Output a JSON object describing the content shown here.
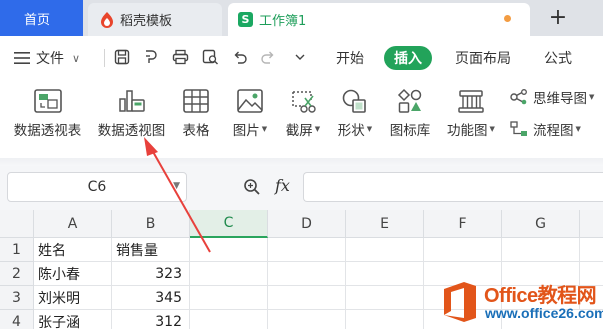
{
  "tabs": {
    "home": "首页",
    "templates": "稻壳模板",
    "workbook": "工作簿1",
    "workbook_logo": "S",
    "new_tab": "+"
  },
  "menu": {
    "file": "文件",
    "items": [
      {
        "label": "开始",
        "active": false
      },
      {
        "label": "插入",
        "active": true
      },
      {
        "label": "页面布局",
        "active": false
      },
      {
        "label": "公式",
        "active": false
      }
    ]
  },
  "ribbon": {
    "pivot_table": "数据透视表",
    "pivot_chart": "数据透视图",
    "table": "表格",
    "picture": "图片",
    "screenshot": "截屏",
    "shapes": "形状",
    "icon_library": "图标库",
    "function_chart": "功能图",
    "mind_map": "思维导图",
    "flowchart": "流程图"
  },
  "formula_bar": {
    "cell_ref": "C6",
    "fx": "fx",
    "value": ""
  },
  "sheet": {
    "columns": [
      "A",
      "B",
      "C",
      "D",
      "E",
      "F",
      "G"
    ],
    "selected_column": "C",
    "rows": [
      {
        "num": "1",
        "a": "姓名",
        "b": "销售量"
      },
      {
        "num": "2",
        "a": "陈小春",
        "b": "323"
      },
      {
        "num": "3",
        "a": "刘米明",
        "b": "345"
      },
      {
        "num": "4",
        "a": "张子涵",
        "b": "312"
      }
    ]
  },
  "watermark": {
    "title": "Office教程网",
    "url": "www.office26.com"
  },
  "colors": {
    "accent_green": "#22a35a",
    "home_tab_blue": "#2f6bea",
    "arrow_red": "#e8413c",
    "watermark_orange": "#e2551a",
    "watermark_blue": "#1a6fb8"
  }
}
